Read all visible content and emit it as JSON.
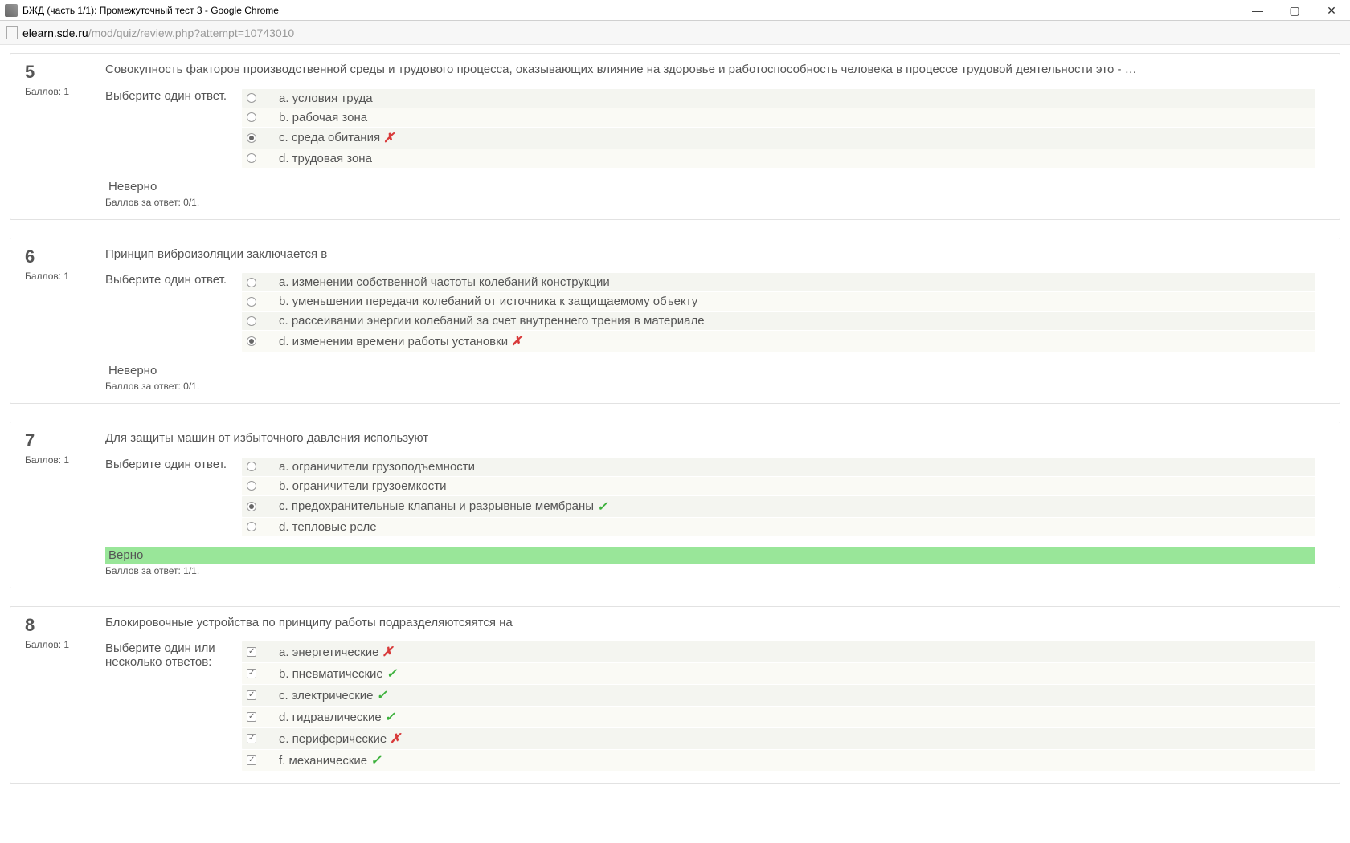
{
  "window": {
    "title": "БЖД (часть 1/1): Промежуточный тест 3 - Google Chrome",
    "url_host": "elearn.sde.ru",
    "url_path": "/mod/quiz/review.php?attempt=10743010"
  },
  "labels": {
    "points_prefix": "Баллов:",
    "choose_one": "Выберите один ответ.",
    "choose_many": "Выберите один или несколько ответов:",
    "wrong": "Неверно",
    "right": "Верно",
    "score_prefix": "Баллов за ответ:"
  },
  "questions": [
    {
      "num": "5",
      "points": "1",
      "multi": false,
      "text": "Совокупность факторов производственной среды и трудового процесса, оказывающих влияние на здоровье и работоспособность человека в процессе трудовой деятельности это - …",
      "answers": [
        {
          "l": "a.",
          "t": "условия труда",
          "sel": false,
          "mark": ""
        },
        {
          "l": "b.",
          "t": "рабочая зона",
          "sel": false,
          "mark": ""
        },
        {
          "l": "c.",
          "t": "среда обитания",
          "sel": true,
          "mark": "bad"
        },
        {
          "l": "d.",
          "t": "трудовая зона",
          "sel": false,
          "mark": ""
        }
      ],
      "correct": false,
      "score": "0/1."
    },
    {
      "num": "6",
      "points": "1",
      "multi": false,
      "text": "Принцип виброизоляции заключается в",
      "answers": [
        {
          "l": "a.",
          "t": "изменении собственной частоты колебаний конструкции",
          "sel": false,
          "mark": ""
        },
        {
          "l": "b.",
          "t": "уменьшении передачи колебаний от источника к защищаемому объекту",
          "sel": false,
          "mark": ""
        },
        {
          "l": "c.",
          "t": "рассеивании энергии колебаний за счет внутреннего трения в материале",
          "sel": false,
          "mark": ""
        },
        {
          "l": "d.",
          "t": "изменении времени работы установки",
          "sel": true,
          "mark": "bad"
        }
      ],
      "correct": false,
      "score": "0/1."
    },
    {
      "num": "7",
      "points": "1",
      "multi": false,
      "text": "Для защиты машин от избыточного давления используют",
      "answers": [
        {
          "l": "a.",
          "t": "ограничители грузоподъемности",
          "sel": false,
          "mark": ""
        },
        {
          "l": "b.",
          "t": "ограничители грузоемкости",
          "sel": false,
          "mark": ""
        },
        {
          "l": "c.",
          "t": "предохранительные клапаны и разрывные мембраны",
          "sel": true,
          "mark": "ok"
        },
        {
          "l": "d.",
          "t": "тепловые реле",
          "sel": false,
          "mark": ""
        }
      ],
      "correct": true,
      "score": "1/1."
    },
    {
      "num": "8",
      "points": "1",
      "multi": true,
      "text": "Блокировочные устройства по принципу работы подразделяютсяятся на",
      "answers": [
        {
          "l": "a.",
          "t": "энергетические",
          "sel": true,
          "mark": "bad"
        },
        {
          "l": "b.",
          "t": "пневматические",
          "sel": true,
          "mark": "ok"
        },
        {
          "l": "c.",
          "t": "электрические",
          "sel": true,
          "mark": "ok"
        },
        {
          "l": "d.",
          "t": "гидравлические",
          "sel": true,
          "mark": "ok"
        },
        {
          "l": "e.",
          "t": "периферические",
          "sel": true,
          "mark": "bad"
        },
        {
          "l": "f.",
          "t": "механические",
          "sel": true,
          "mark": "ok"
        }
      ],
      "correct": null,
      "score": ""
    }
  ]
}
